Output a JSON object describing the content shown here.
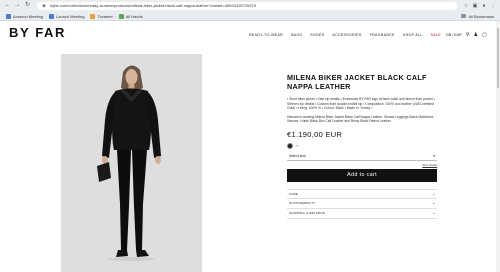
{
  "browser": {
    "url": "byfar.com/collections/ready-to-wear/products/milena-biker-jacket-black-calf-nappa-leather?variant=46943125725379",
    "bookmarks": [
      {
        "label": "Amazon Meeting",
        "icon": "calendar"
      },
      {
        "label": "Launch Meeting",
        "icon": "calendar"
      },
      {
        "label": "Tocamet",
        "icon": "globe"
      },
      {
        "label": "All Hands",
        "icon": "globe"
      }
    ],
    "all_bookmarks_label": "All Bookmarks"
  },
  "header": {
    "logo": "BY FAR",
    "nav": [
      "READY-TO-WEAR",
      "BAGS",
      "SHOES",
      "ACCESSORIES",
      "FRAGRANCE",
      "SHOP ALL",
      "SALE"
    ],
    "locale": "GB / EUR"
  },
  "product": {
    "title": "MILENA BIKER JACKET BLACK CALF NAPPA LEATHER",
    "description": "• Short biker jacket • Side zip details • Embossed BY FAR logo at back collar and above front pocket • Sleeves zip details • Custom front double-ended zip • Composition: 100% cow leather (LWG-certified Gold) • Lining: 100% VI • Colour: Black • Made in: Turkey •",
    "model_info": "Hannah is wearing Milena Biker Jacket Black Calf Nappa Leather, Shania Leggings Black Matchless Viscose, Hubbi Black Box Calf Leather and Remy Black Patent Leather",
    "price": "€1.190,00 EUR",
    "swatch_color": "#222222",
    "swatch_more": "+",
    "size_placeholder": "Select size",
    "size_guide": "Size Guide",
    "add_to_cart": "Add to cart",
    "accordion": [
      "CARE",
      "SUSTAINABILITY",
      "SHIPPING & RETURNS"
    ]
  }
}
